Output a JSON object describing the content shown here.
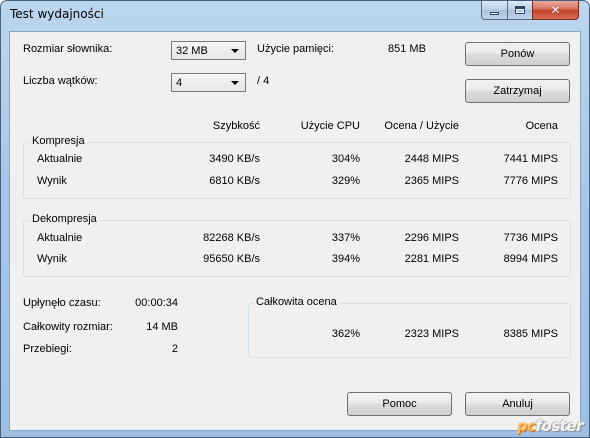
{
  "window": {
    "title": "Test wydajności",
    "minimize_icon": "minimize-icon",
    "maximize_icon": "maximize-icon",
    "close_icon": "close-icon",
    "close_glyph": "✕"
  },
  "settings": {
    "dictionary_label": "Rozmiar słownika:",
    "dictionary_value": "32 MB",
    "threads_label": "Liczba wątków:",
    "threads_value": "4",
    "threads_max": "/ 4",
    "memory_label": "Użycie pamięci:",
    "memory_value": "851 MB"
  },
  "buttons": {
    "restart": "Ponów",
    "stop": "Zatrzymaj",
    "help": "Pomoc",
    "cancel": "Anuluj"
  },
  "columns": {
    "speed": "Szybkość",
    "cpu": "Użycie CPU",
    "rating_usage": "Ocena / Użycie",
    "rating": "Ocena"
  },
  "compression": {
    "label": "Kompresja",
    "rows": [
      {
        "label": "Aktualnie",
        "speed": "3490 KB/s",
        "cpu": "304%",
        "rating_usage": "2448 MIPS",
        "rating": "7441 MIPS"
      },
      {
        "label": "Wynik",
        "speed": "6810 KB/s",
        "cpu": "329%",
        "rating_usage": "2365 MIPS",
        "rating": "7776 MIPS"
      }
    ]
  },
  "decompression": {
    "label": "Dekompresja",
    "rows": [
      {
        "label": "Aktualnie",
        "speed": "82268 KB/s",
        "cpu": "337%",
        "rating_usage": "2296 MIPS",
        "rating": "7736 MIPS"
      },
      {
        "label": "Wynik",
        "speed": "95650 KB/s",
        "cpu": "394%",
        "rating_usage": "2281 MIPS",
        "rating": "8994 MIPS"
      }
    ]
  },
  "stats": {
    "elapsed_label": "Upłynęło czasu:",
    "elapsed_value": "00:00:34",
    "size_label": "Całkowity rozmiar:",
    "size_value": "14 MB",
    "passes_label": "Przebiegi:",
    "passes_value": "2"
  },
  "total": {
    "label": "Całkowita ocena",
    "cpu": "362%",
    "rating_usage": "2323 MIPS",
    "rating": "8385 MIPS"
  },
  "watermark": {
    "part1": "pc",
    "part2": "foster"
  }
}
